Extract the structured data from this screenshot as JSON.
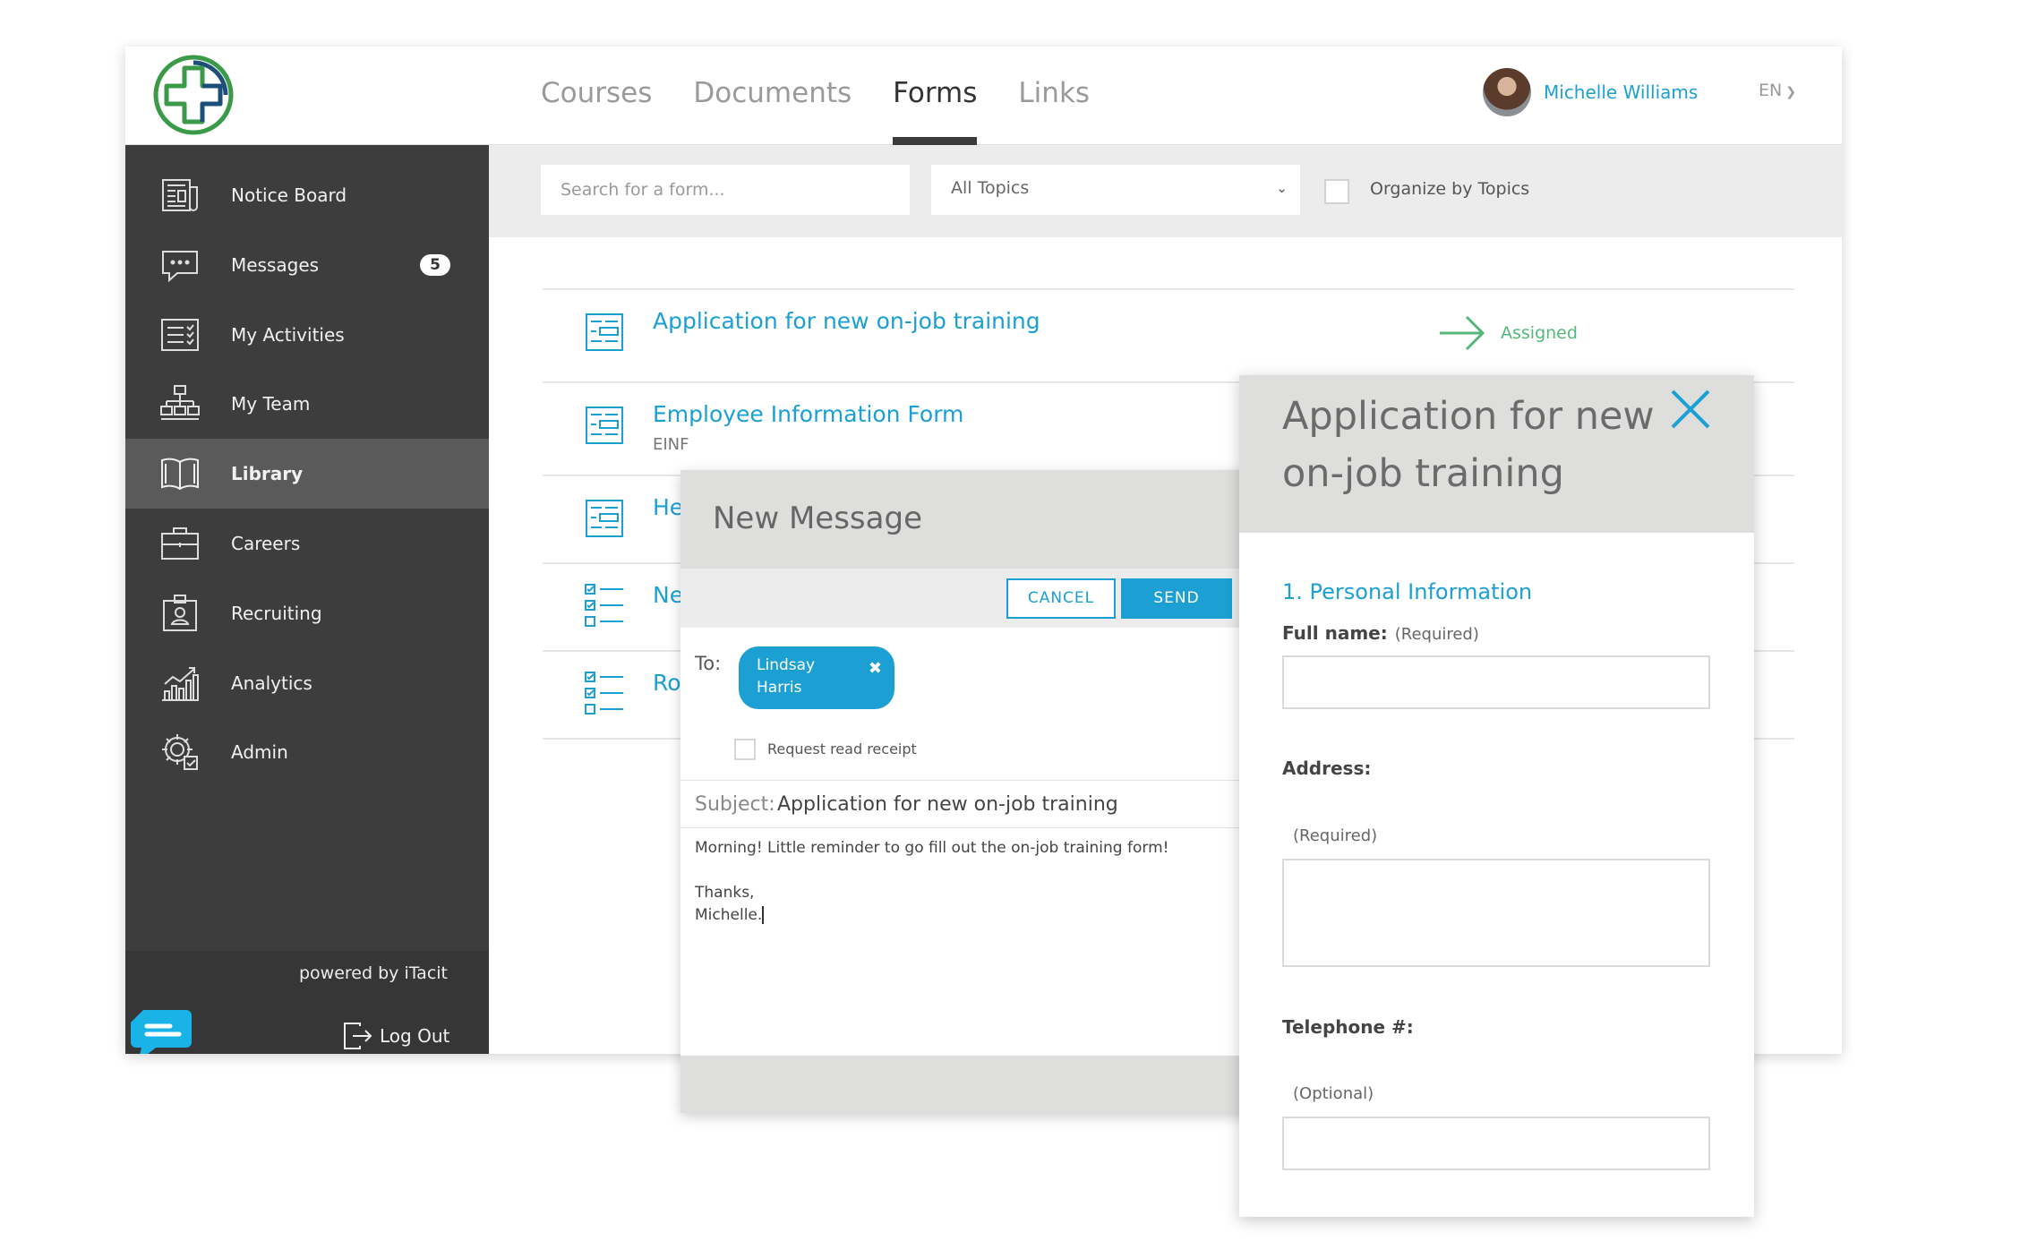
{
  "topbar": {
    "tabs": [
      "Courses",
      "Documents",
      "Forms",
      "Links"
    ],
    "active_tab": "Forms",
    "user_name": "Michelle Williams",
    "language": "EN"
  },
  "sidebar": {
    "items": [
      {
        "label": "Notice Board",
        "icon": "newspaper-icon"
      },
      {
        "label": "Messages",
        "icon": "chat-icon",
        "badge": "5"
      },
      {
        "label": "My Activities",
        "icon": "checklist-icon"
      },
      {
        "label": "My Team",
        "icon": "org-chart-icon"
      },
      {
        "label": "Library",
        "icon": "book-icon",
        "active": true
      },
      {
        "label": "Careers",
        "icon": "briefcase-icon"
      },
      {
        "label": "Recruiting",
        "icon": "id-badge-icon"
      },
      {
        "label": "Analytics",
        "icon": "bar-chart-icon"
      },
      {
        "label": "Admin",
        "icon": "gear-icon"
      }
    ],
    "powered_by": "powered by iTacit",
    "logout_label": "Log Out"
  },
  "filters": {
    "search_placeholder": "Search for a form...",
    "topic_select": "All Topics",
    "organize_label": "Organize by Topics"
  },
  "forms_list": [
    {
      "title": "Application for new on-job training",
      "subtitle": "",
      "status": "Assigned",
      "icon": "form-icon"
    },
    {
      "title": "Employee Information Form",
      "subtitle": "EINF",
      "status": "",
      "icon": "form-icon"
    },
    {
      "title": "He",
      "subtitle": "",
      "status": "",
      "icon": "form-icon"
    },
    {
      "title": "Ne",
      "subtitle": "",
      "status": "",
      "icon": "checklist-icon"
    },
    {
      "title": "Ro",
      "subtitle": "",
      "status": "",
      "icon": "checklist-icon"
    }
  ],
  "message": {
    "title": "New Message",
    "cancel_label": "CANCEL",
    "send_label": "SEND",
    "to_label": "To:",
    "recipient_line1": "Lindsay",
    "recipient_line2": "Harris",
    "read_receipt_label": "Request read receipt",
    "subject_label": "Subject:",
    "subject_value": "Application for new on-job training",
    "body_line1": "Morning! Little reminder to go fill out the on-job training form!",
    "body_line2": "Thanks,",
    "body_line3": "Michelle."
  },
  "form_panel": {
    "title": "Application for new on-job training",
    "section": "1. Personal Information",
    "fields": [
      {
        "label": "Full name:",
        "hint": "(Required)"
      },
      {
        "label": "Address:",
        "hint": "(Required)"
      },
      {
        "label": "Telephone #:",
        "hint": "(Optional)"
      }
    ]
  },
  "colors": {
    "accent": "#1ca0d3",
    "sidebar": "#3d3d3d",
    "assigned": "#55b87a",
    "logo_green": "#3a9a48",
    "logo_blue": "#1e4f7a"
  }
}
